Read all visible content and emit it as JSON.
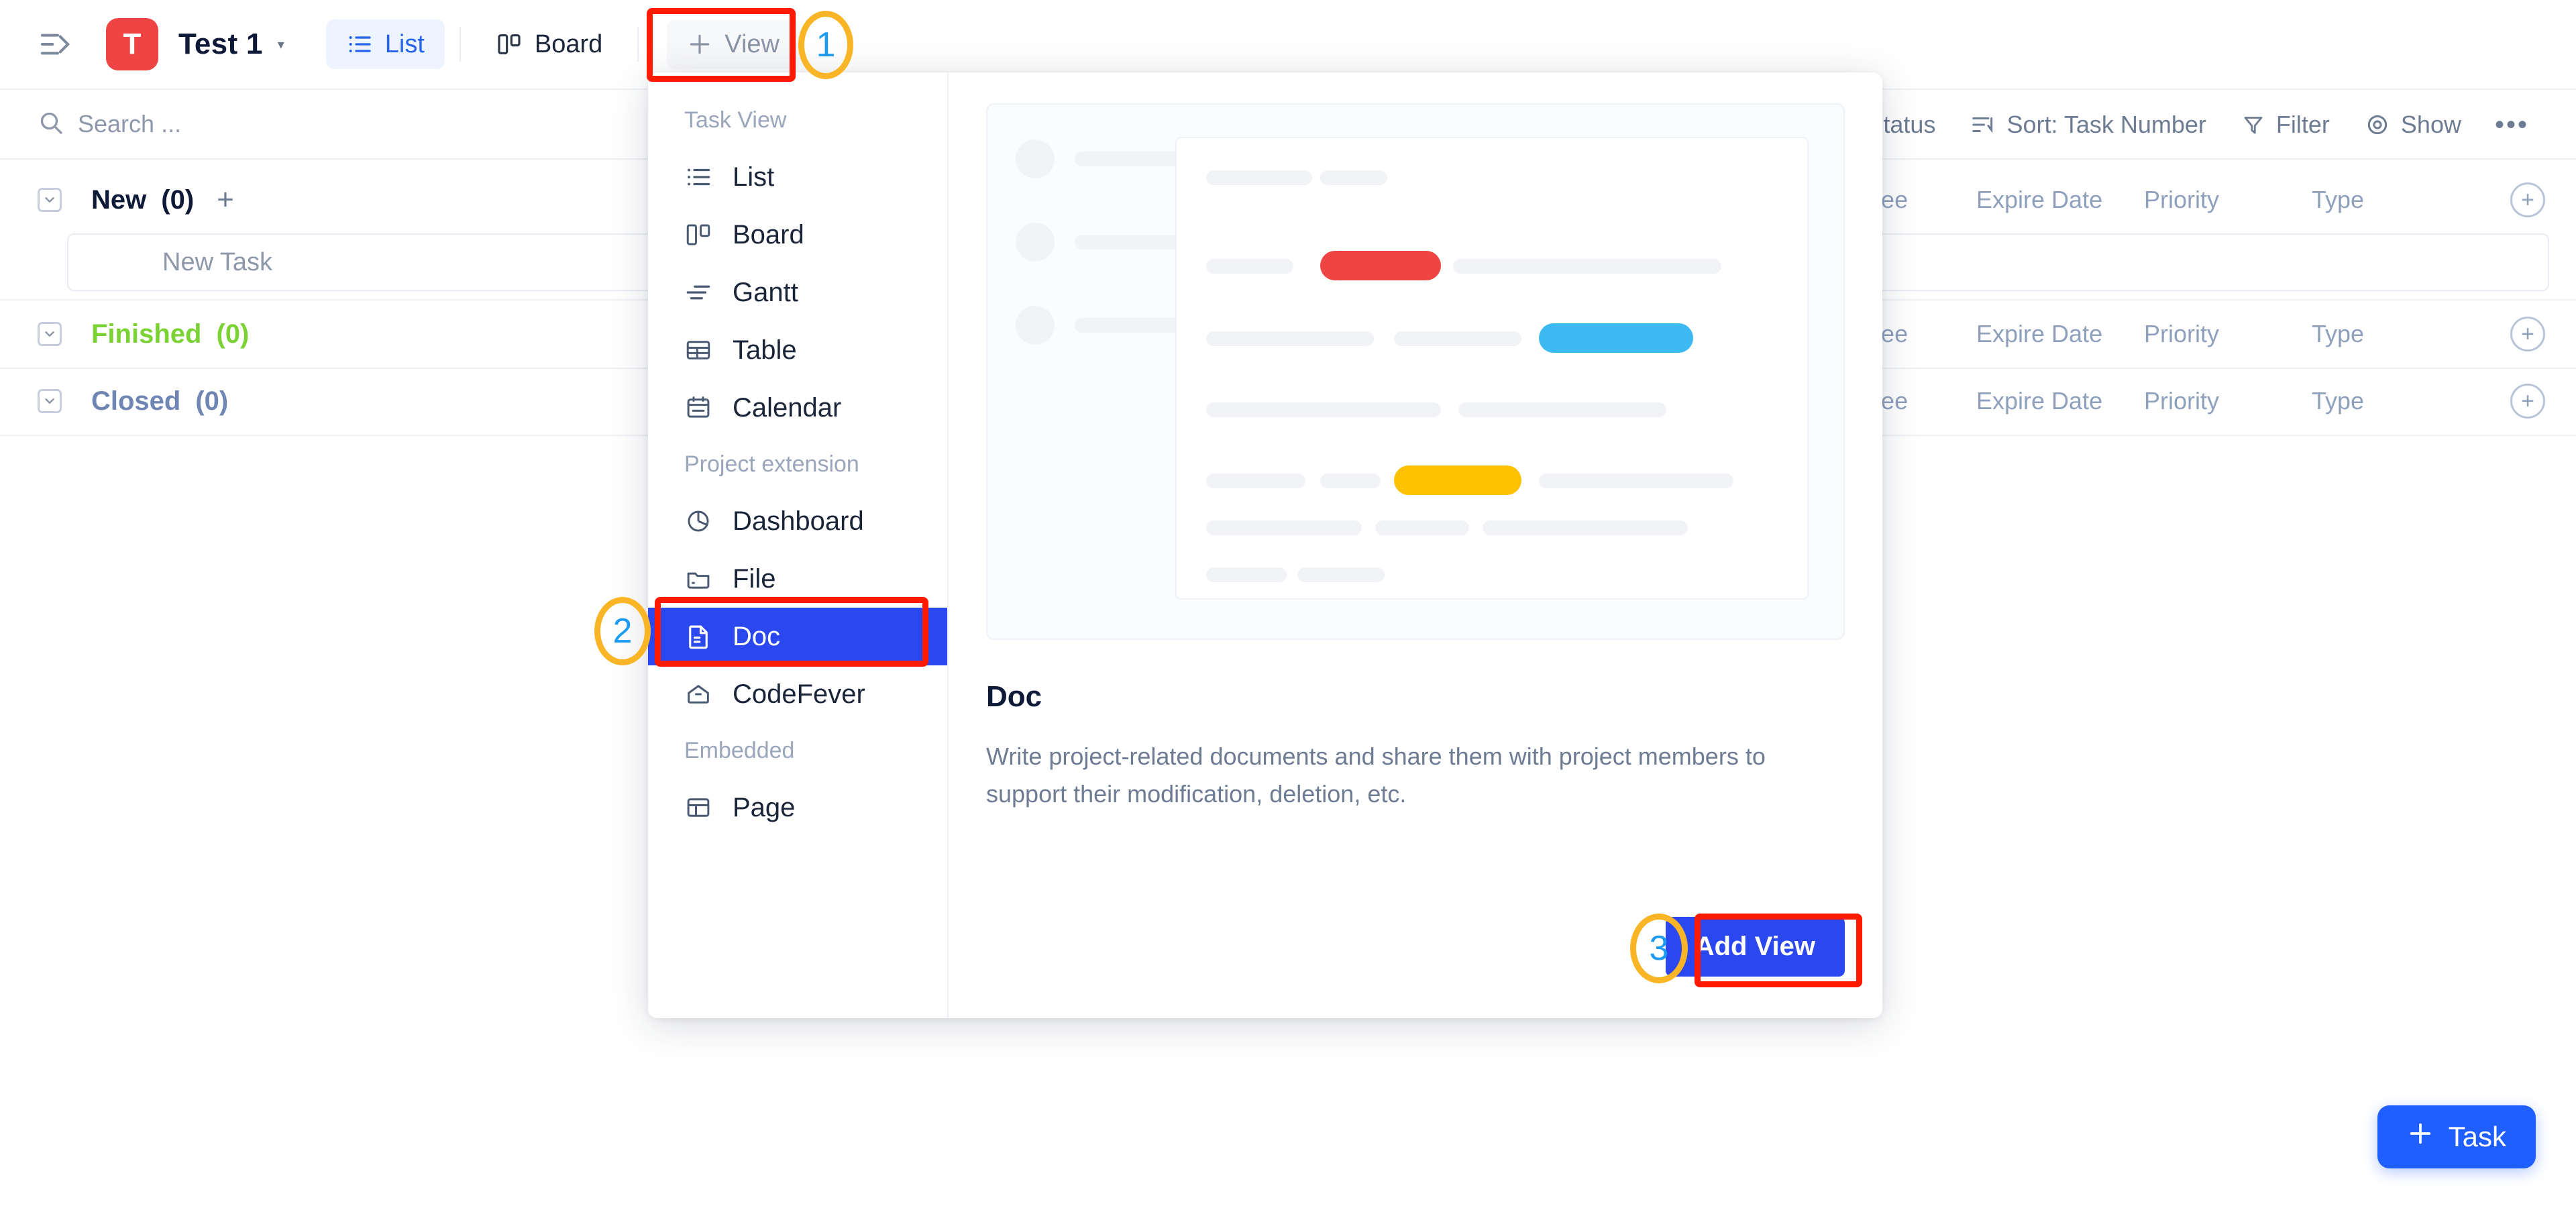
{
  "topbar": {
    "collapse_icon": "sidebar-collapse-icon",
    "project_initial": "T",
    "project_name": "Test 1",
    "project_caret": "▾",
    "tabs": [
      {
        "label": "List",
        "icon": "list-icon",
        "active": true
      },
      {
        "label": "Board",
        "icon": "board-icon",
        "active": false
      }
    ],
    "add_view_label": "View",
    "add_view_plus": "+"
  },
  "search": {
    "placeholder": "Search ...",
    "icon": "search-icon"
  },
  "toolbar": {
    "task_status_label": "Task Status",
    "sort_label": "Sort: Task Number",
    "filter_label": "Filter",
    "show_label": "Show",
    "more_label": "•••"
  },
  "columns": [
    "Assignee",
    "Expire Date",
    "Priority",
    "Type"
  ],
  "column_add": "+",
  "groups": [
    {
      "name": "New",
      "count": "(0)",
      "color": "#0e1a38",
      "add": "+"
    },
    {
      "name": "Finished",
      "count": "(0)",
      "color": "#7bd234",
      "add": ""
    },
    {
      "name": "Closed",
      "count": "(0)",
      "color": "#6f86b5",
      "add": ""
    }
  ],
  "new_task_placeholder": "New Task",
  "popup": {
    "sections": [
      {
        "label": "Task View",
        "items": [
          {
            "label": "List",
            "icon": "list-icon",
            "selected": false
          },
          {
            "label": "Board",
            "icon": "board-icon",
            "selected": false
          },
          {
            "label": "Gantt",
            "icon": "gantt-icon",
            "selected": false
          },
          {
            "label": "Table",
            "icon": "table-icon",
            "selected": false
          },
          {
            "label": "Calendar",
            "icon": "calendar-icon",
            "selected": false
          }
        ]
      },
      {
        "label": "Project extension",
        "items": [
          {
            "label": "Dashboard",
            "icon": "dashboard-icon",
            "selected": false
          },
          {
            "label": "File",
            "icon": "folder-icon",
            "selected": false
          },
          {
            "label": "Doc",
            "icon": "document-icon",
            "selected": true
          },
          {
            "label": "CodeFever",
            "icon": "codefever-icon",
            "selected": false
          }
        ]
      },
      {
        "label": "Embedded",
        "items": [
          {
            "label": "Page",
            "icon": "page-icon",
            "selected": false
          }
        ]
      }
    ],
    "detail": {
      "title": "Doc",
      "description": "Write project-related documents and share them with project members to support their modification, deletion, etc.",
      "add_button": "Add View"
    },
    "preview": {
      "bars": [
        {
          "color": "#ef4444"
        },
        {
          "color": "#3bb9f0"
        },
        {
          "color": "#fcc100"
        }
      ]
    }
  },
  "fab": {
    "plus": "+",
    "label": "Task"
  },
  "annotations": [
    {
      "number": "1"
    },
    {
      "number": "2"
    },
    {
      "number": "3"
    }
  ],
  "colors": {
    "accent_blue": "#2b48f0",
    "highlight_red": "#ff1a00",
    "annotation_orange": "#f9b526",
    "annotation_number_blue": "#1d9bf0",
    "logo_red": "#ef4444",
    "finished_green": "#7bd234"
  }
}
